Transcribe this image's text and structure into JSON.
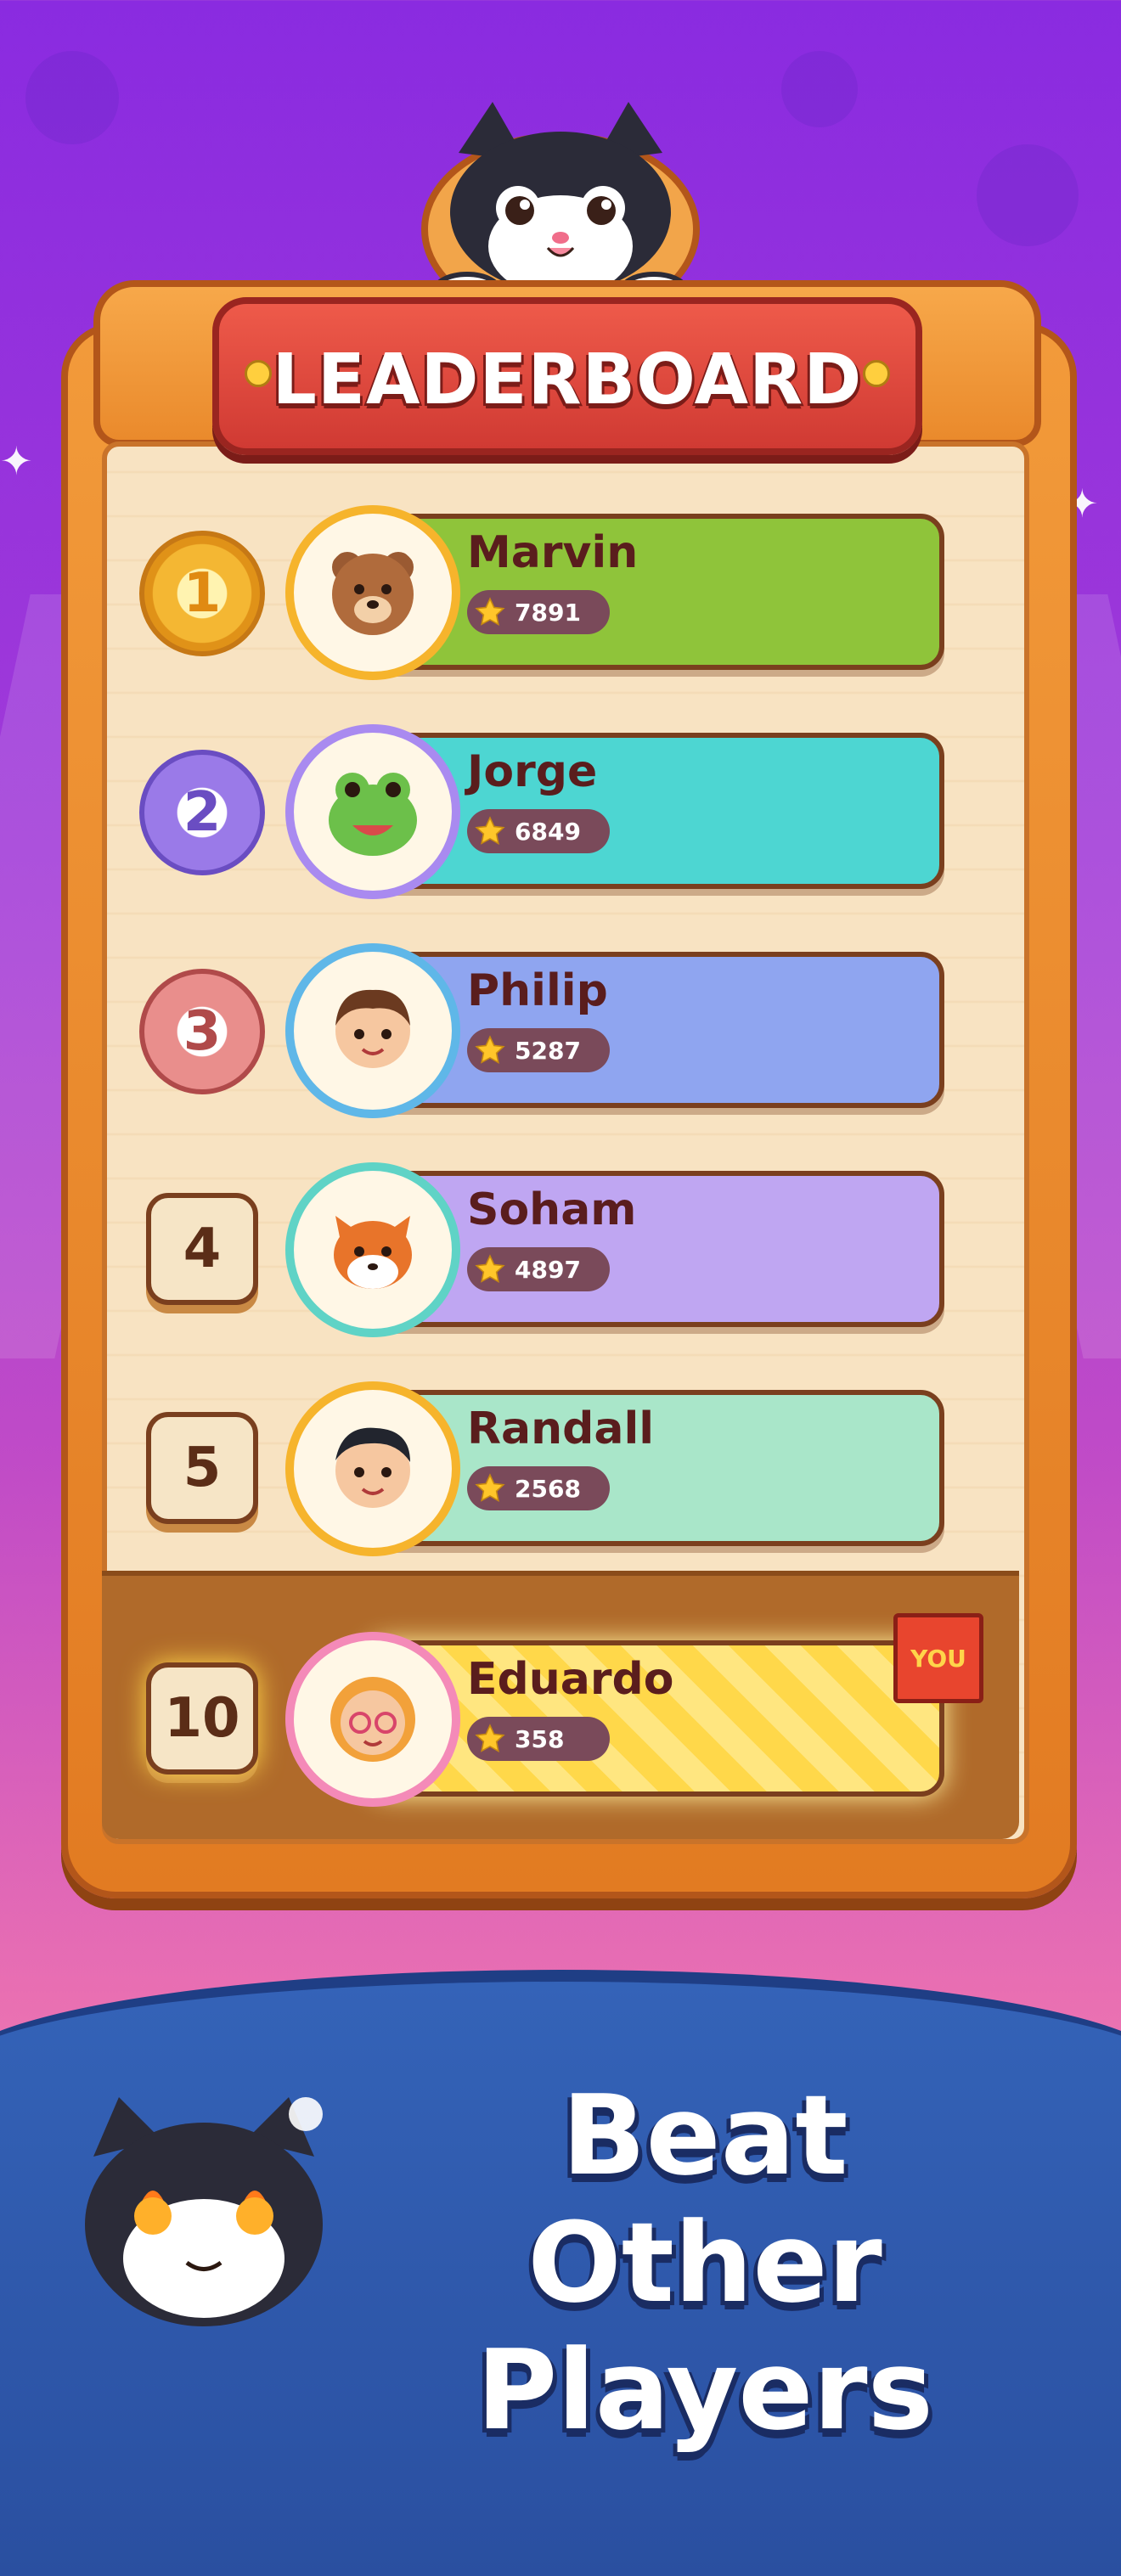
{
  "header": {
    "title": "LEADERBOARD"
  },
  "colors": {
    "accent_red": "#d93b33",
    "board_orange": "#ea8a2c",
    "bottom_blue": "#2e56aa"
  },
  "rows": [
    {
      "rank": "1",
      "name": "Marvin",
      "score": "7891",
      "bar_color": "#8fc43a",
      "rank_style": "gold-medal"
    },
    {
      "rank": "2",
      "name": "Jorge",
      "score": "6849",
      "bar_color": "#4dd6d2",
      "rank_style": "purple-medal"
    },
    {
      "rank": "3",
      "name": "Philip",
      "score": "5287",
      "bar_color": "#8fa5f0",
      "rank_style": "red-medal"
    },
    {
      "rank": "4",
      "name": "Soham",
      "score": "4897",
      "bar_color": "#bfa6f2",
      "rank_style": "box"
    },
    {
      "rank": "5",
      "name": "Randall",
      "score": "2568",
      "bar_color": "#a9e6c9",
      "rank_style": "box"
    }
  ],
  "player": {
    "rank": "10",
    "name": "Eduardo",
    "score": "358",
    "badge": "YOU",
    "bar_color": "#ffd84a"
  },
  "promo": {
    "line1": "Beat",
    "line2": "Other Players"
  },
  "icons": {
    "star": "star-icon",
    "cat": "cat-mascot",
    "sparkle": "sparkle-icon"
  }
}
